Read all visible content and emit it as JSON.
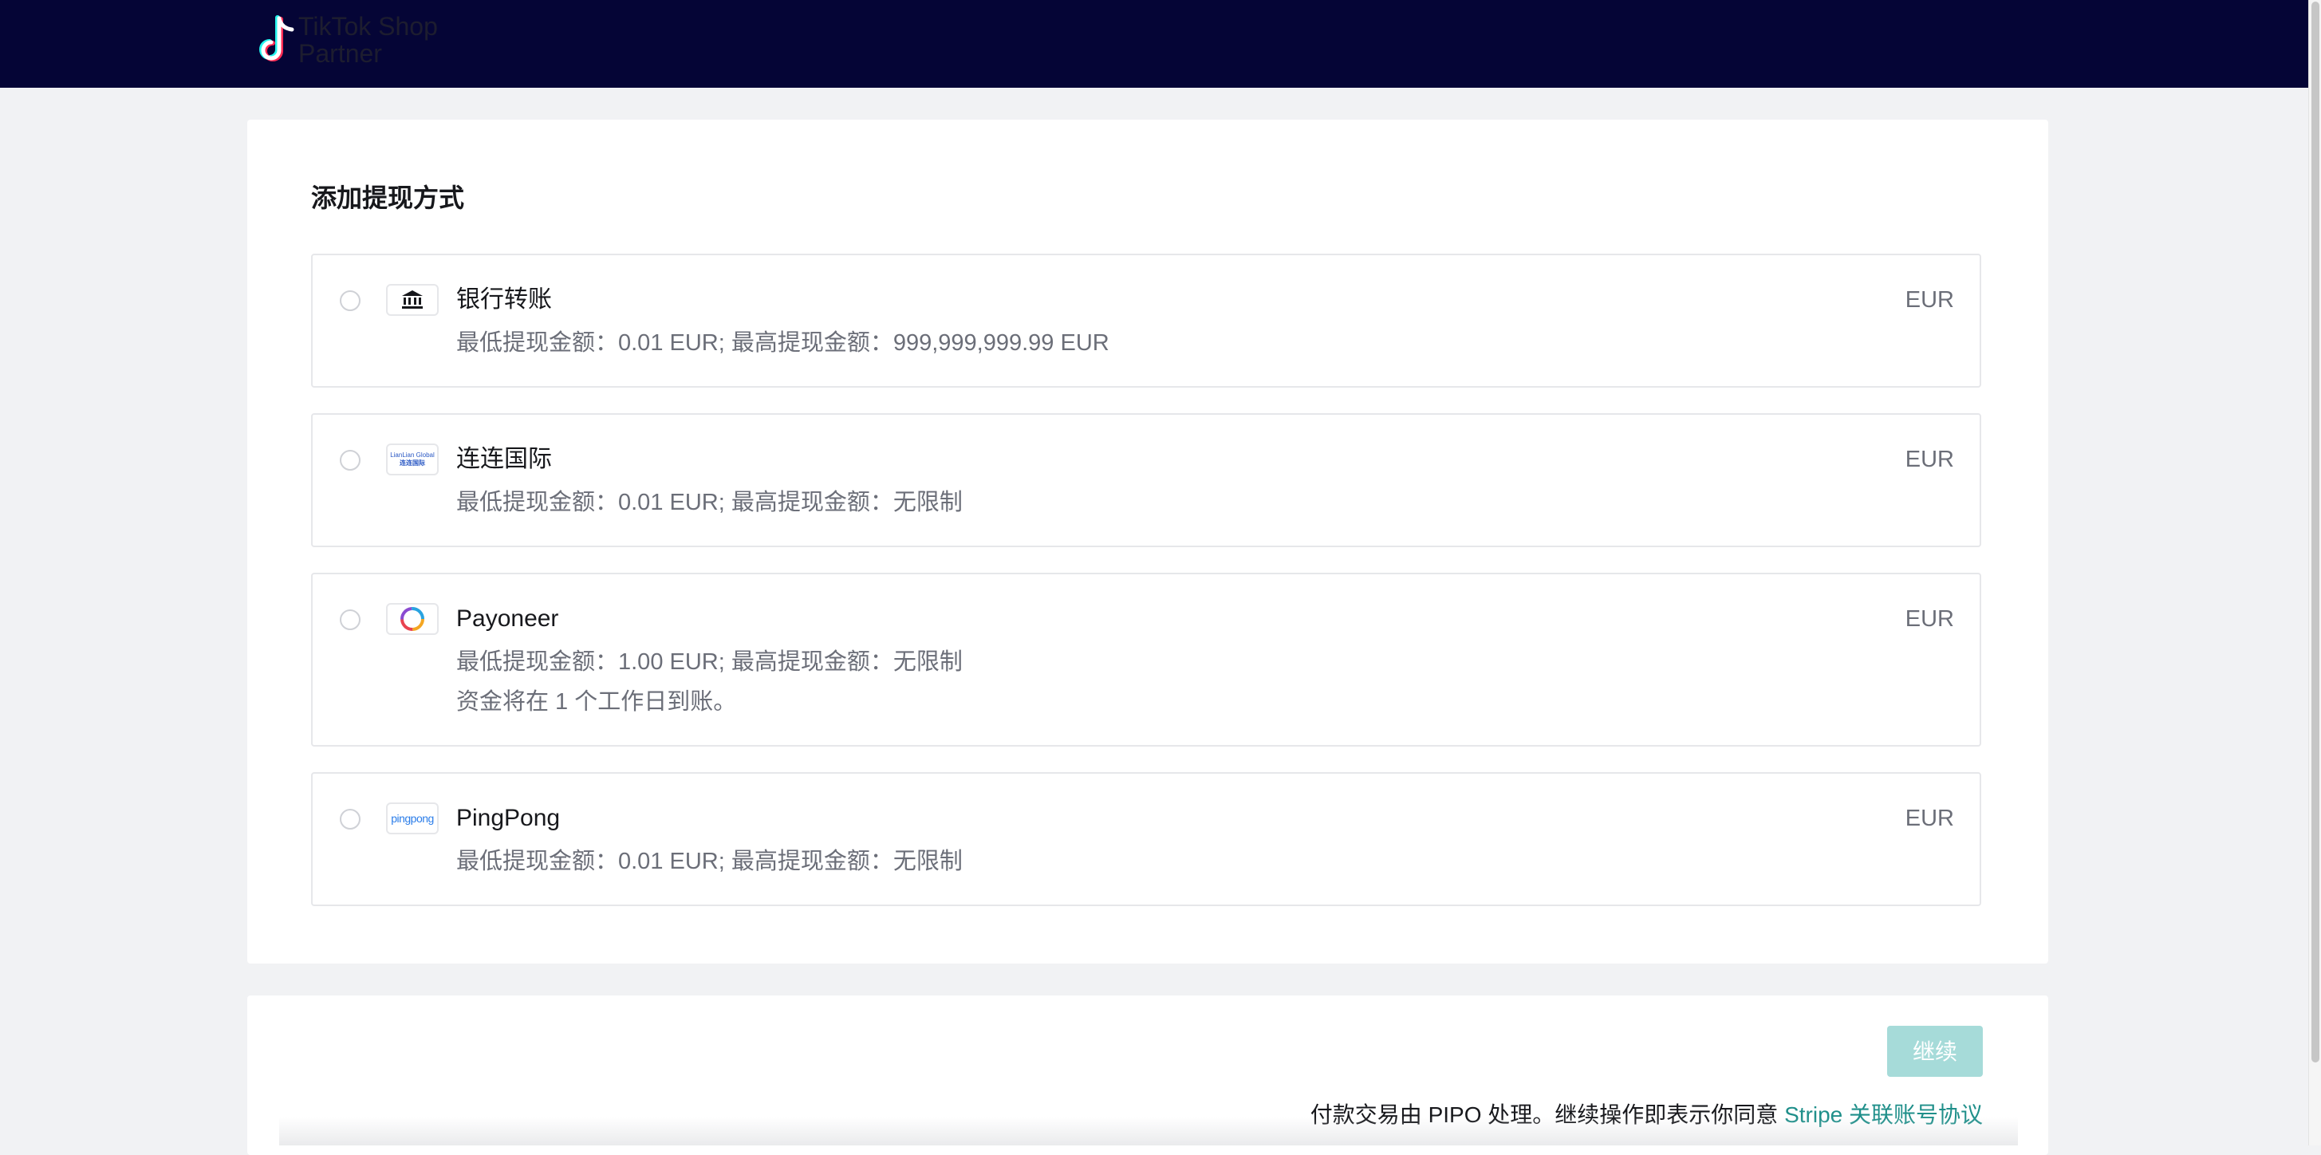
{
  "header": {
    "brand_line1": "TikTok Shop",
    "brand_line2": "Partner",
    "logo_icon": "tiktok-logo-icon"
  },
  "page": {
    "title": "添加提现方式"
  },
  "methods": [
    {
      "name": "银行转账",
      "icon": "bank-icon",
      "limits": "最低提现金额：0.01 EUR; 最高提现金额：999,999,999.99 EUR",
      "note": "",
      "currency": "EUR"
    },
    {
      "name": "连连国际",
      "icon": "lianlian-global-icon",
      "icon_text_line1": "LianLian Global",
      "icon_text_line2": "连连国际",
      "limits": "最低提现金额：0.01 EUR; 最高提现金额：无限制",
      "note": "",
      "currency": "EUR"
    },
    {
      "name": "Payoneer",
      "icon": "payoneer-icon",
      "limits": "最低提现金额：1.00 EUR; 最高提现金额：无限制",
      "note": "资金将在 1 个工作日到账。",
      "currency": "EUR"
    },
    {
      "name": "PingPong",
      "icon": "pingpong-icon",
      "icon_text": "pingpong",
      "limits": "最低提现金额：0.01 EUR; 最高提现金额：无限制",
      "note": "",
      "currency": "EUR"
    }
  ],
  "footer": {
    "continue_label": "继续",
    "terms_text": "付款交易由 PIPO 处理。继续操作即表示你同意 ",
    "terms_link": "Stripe 关联账号协议"
  },
  "colors": {
    "header_bg": "#050536",
    "accent": "#1f8f8a",
    "button_disabled": "#a6dbd9"
  }
}
